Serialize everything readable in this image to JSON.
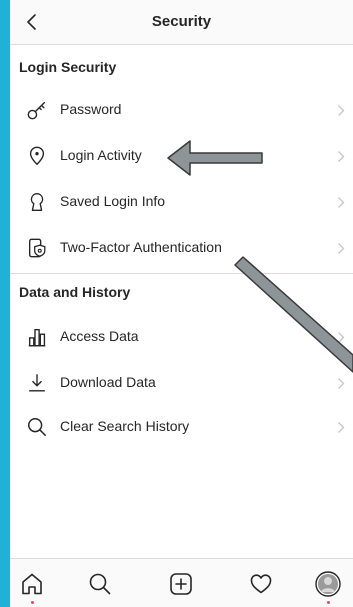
{
  "header": {
    "title": "Security",
    "back_icon": "chevron-left-icon"
  },
  "sections": [
    {
      "title": "Login Security",
      "items": [
        {
          "label": "Password",
          "icon": "key-icon"
        },
        {
          "label": "Login Activity",
          "icon": "location-pin-icon"
        },
        {
          "label": "Saved Login Info",
          "icon": "keyhole-icon"
        },
        {
          "label": "Two-Factor Authentication",
          "icon": "phone-shield-icon"
        }
      ]
    },
    {
      "title": "Data and History",
      "items": [
        {
          "label": "Access Data",
          "icon": "bar-chart-icon"
        },
        {
          "label": "Download Data",
          "icon": "download-icon"
        },
        {
          "label": "Clear Search History",
          "icon": "search-icon"
        }
      ]
    }
  ],
  "bottom_nav": [
    {
      "icon": "home-icon"
    },
    {
      "icon": "search-icon"
    },
    {
      "icon": "new-post-icon"
    },
    {
      "icon": "heart-icon"
    },
    {
      "icon": "profile-avatar"
    }
  ],
  "colors": {
    "frame": "#1fb2d6",
    "text": "#262626",
    "divider": "#dbdbdb",
    "chevron": "#c7c7c7",
    "notification_dot": "#ed4956",
    "annotation_arrow": "#8d9598"
  }
}
